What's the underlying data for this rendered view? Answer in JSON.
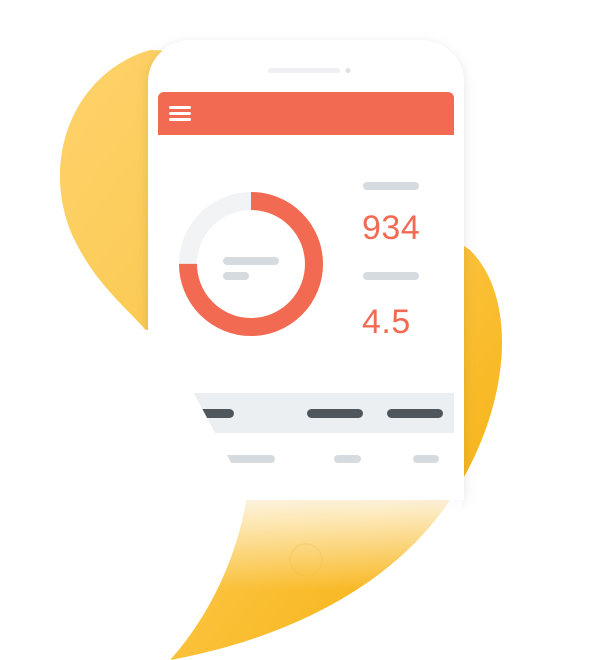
{
  "colors": {
    "accent": "#f26a52",
    "blob_light": "#fdd068",
    "blob_dark": "#f8b20d",
    "skeleton": "#d6dbdf",
    "skeleton_dark": "#4f565c",
    "panel_bg": "#eceff1"
  },
  "header": {
    "menu_icon": "hamburger-menu-icon"
  },
  "donut": {
    "fraction_filled": 0.75
  },
  "metrics": [
    {
      "value": "934"
    },
    {
      "value": "4.5"
    }
  ]
}
